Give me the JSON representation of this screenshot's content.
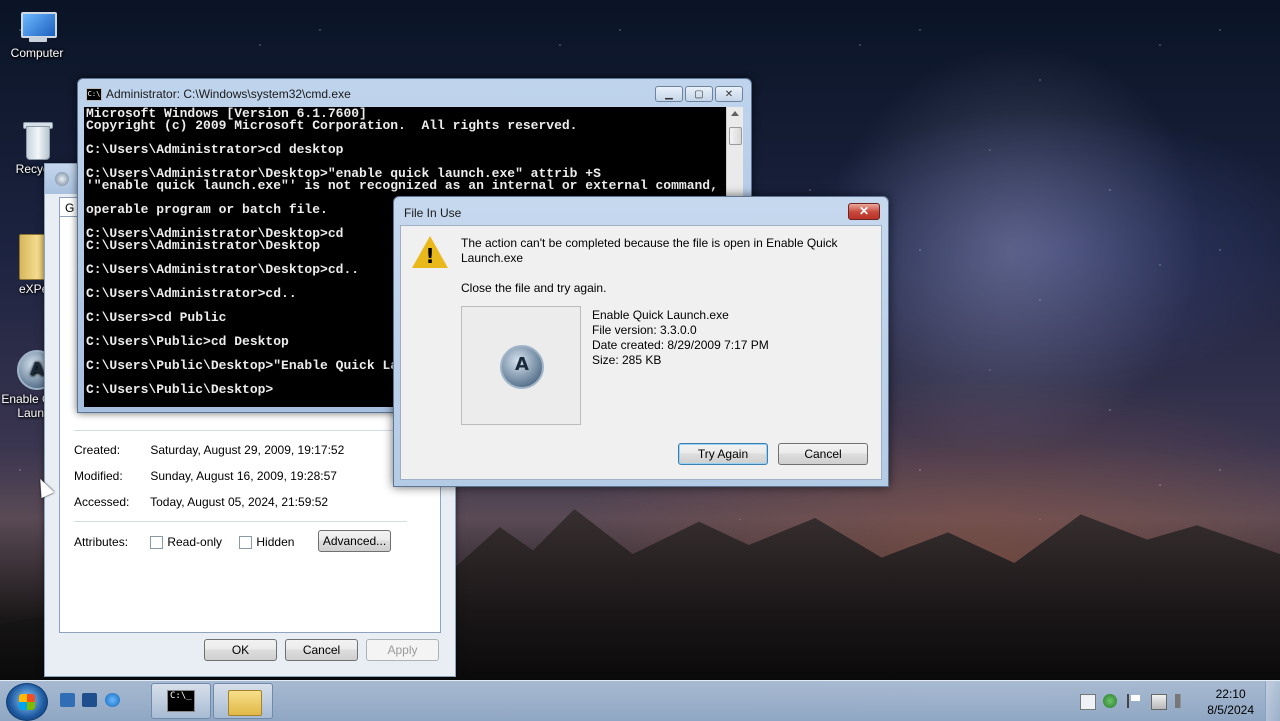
{
  "desktop": {
    "icons": [
      {
        "label": "Computer"
      },
      {
        "label": "Recycle"
      },
      {
        "label": "eXPeri"
      },
      {
        "label": "Enable Quick Launch"
      }
    ]
  },
  "properties_window": {
    "tab_stub": "G",
    "created_label": "Created:",
    "created_value": "Saturday, August 29, 2009, 19:17:52",
    "modified_label": "Modified:",
    "modified_value": "Sunday, August 16, 2009, 19:28:57",
    "accessed_label": "Accessed:",
    "accessed_value": "Today, August 05, 2024, 21:59:52",
    "attributes_label": "Attributes:",
    "readonly_label": "Read-only",
    "hidden_label": "Hidden",
    "advanced_button": "Advanced...",
    "ok_button": "OK",
    "cancel_button": "Cancel",
    "apply_button": "Apply"
  },
  "cmd_window": {
    "title": "Administrator: C:\\Windows\\system32\\cmd.exe",
    "icon_text": "C:\\",
    "lines": "Microsoft Windows [Version 6.1.7600]\nCopyright (c) 2009 Microsoft Corporation.  All rights reserved.\n\nC:\\Users\\Administrator>cd desktop\n\nC:\\Users\\Administrator\\Desktop>\"enable quick launch.exe\" attrib +S\n'\"enable quick launch.exe\"' is not recognized as an internal or external command,\n\noperable program or batch file.\n\nC:\\Users\\Administrator\\Desktop>cd\nC:\\Users\\Administrator\\Desktop\n\nC:\\Users\\Administrator\\Desktop>cd..\n\nC:\\Users\\Administrator>cd..\n\nC:\\Users>cd Public\n\nC:\\Users\\Public>cd Desktop\n\nC:\\Users\\Public\\Desktop>\"Enable Quick Launch.exe\" attrib +S\n\nC:\\Users\\Public\\Desktop>"
  },
  "dialog": {
    "title": "File In Use",
    "message": "The action can't be completed because the file is open in Enable Quick Launch.exe",
    "instruction": "Close the file and try again.",
    "file_name": "Enable Quick Launch.exe",
    "file_version": "File version: 3.3.0.0",
    "date_created": "Date created: 8/29/2009 7:17 PM",
    "size": "Size: 285 KB",
    "try_again_button": "Try Again",
    "cancel_button": "Cancel",
    "close_glyph": "✕",
    "warning_glyph": "!"
  },
  "taskbar": {
    "clock_time": "22:10",
    "clock_date": "8/5/2024",
    "cmd_icon_text": "C:\\_"
  },
  "icons": {
    "start": "windows-orb-icon",
    "cmd": "cmd-icon",
    "folder": "folder-icon",
    "warning": "warning-icon",
    "app": "quick-launch-app-icon"
  },
  "colors": {
    "cmd_background": "#000000",
    "cmd_text": "#ededed",
    "dialog_close": "#c7463a",
    "warning": "#e9b91b"
  }
}
